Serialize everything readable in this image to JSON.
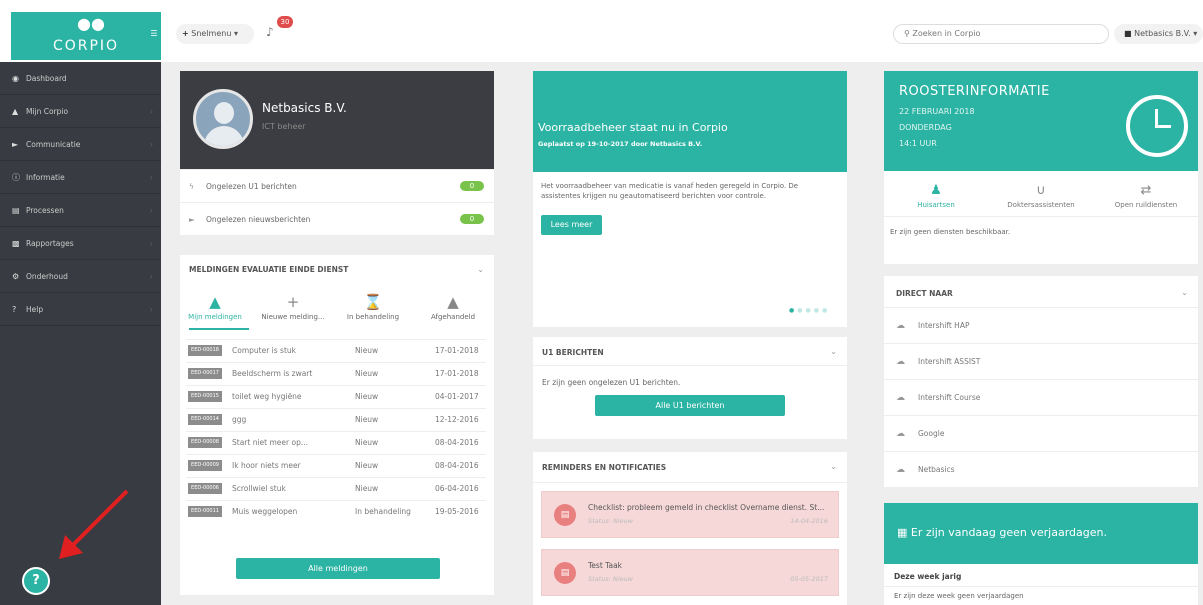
{
  "topbar": {
    "logo_text": "CORPIO",
    "menu_toggle_icon": "menu-icon",
    "quick_menu_label": "Snelmenu ▾",
    "notifications_count": "30",
    "search_placeholder": "Zoeken in Corpio",
    "user_label": "Netbasics B.V. ▾"
  },
  "sidebar": {
    "items": [
      {
        "label": "Dashboard",
        "icon": "dashboard-icon"
      },
      {
        "label": "Mijn Corpio",
        "icon": "user-icon"
      },
      {
        "label": "Communicatie",
        "icon": "megaphone-icon"
      },
      {
        "label": "Informatie",
        "icon": "info-icon"
      },
      {
        "label": "Processen",
        "icon": "list-icon"
      },
      {
        "label": "Rapportages",
        "icon": "bar-chart-icon"
      },
      {
        "label": "Onderhoud",
        "icon": "gear-icon"
      },
      {
        "label": "Help",
        "icon": "question-icon"
      }
    ],
    "help_button": "?"
  },
  "profile": {
    "name": "Netbasics B.V.",
    "role": "ICT beheer",
    "stats": [
      {
        "label": "Ongelezen U1 berichten",
        "count": "0"
      },
      {
        "label": "Ongelezen nieuwsberichten",
        "count": "0"
      }
    ]
  },
  "meldingen": {
    "title": "MELDINGEN EVALUATIE EINDE DIENST",
    "tabs": [
      "Mijn meldingen",
      "Nieuwe melding...",
      "In behandeling",
      "Afgehandeld"
    ],
    "rows": [
      {
        "code": "EED-00018",
        "title": "Computer is stuk",
        "status": "Nieuw",
        "date": "17-01-2018"
      },
      {
        "code": "EED-00017",
        "title": "Beeldscherm is zwart",
        "status": "Nieuw",
        "date": "17-01-2018"
      },
      {
        "code": "EED-00015",
        "title": "toilet weg hygiëne",
        "status": "Nieuw",
        "date": "04-01-2017"
      },
      {
        "code": "EED-00014",
        "title": "ggg",
        "status": "Nieuw",
        "date": "12-12-2016"
      },
      {
        "code": "EED-00008",
        "title": "Start niet meer op...",
        "status": "Nieuw",
        "date": "08-04-2016"
      },
      {
        "code": "EED-00009",
        "title": "Ik hoor niets meer",
        "status": "Nieuw",
        "date": "08-04-2016"
      },
      {
        "code": "EED-00006",
        "title": "Scrollwiel stuk",
        "status": "Nieuw",
        "date": "06-04-2016"
      },
      {
        "code": "EED-00011",
        "title": "Muis weggelopen",
        "status": "In behandeling",
        "date": "19-05-2016"
      }
    ],
    "button": "Alle meldingen"
  },
  "news": {
    "title": "Voorraadbeheer staat nu in Corpio",
    "subtitle": "Geplaatst op 19-10-2017 door Netbasics B.V.",
    "body": "Het voorraadbeheer van medicatie is vanaf heden geregeld in Corpio. De assistentes krijgen nu geautomatiseerd berichten voor controle.",
    "button": "Lees meer"
  },
  "u1": {
    "title": "U1 BERICHTEN",
    "text": "Er zijn geen ongelezen U1 berichten.",
    "button": "Alle U1 berichten"
  },
  "reminders": {
    "title": "REMINDERS EN NOTIFICATIES",
    "items": [
      {
        "title": "Checklist: probleem gemeld in checklist Overname dienst. St...",
        "status": "Status: Nieuw",
        "date": "14-04-2016"
      },
      {
        "title": "Test Taak",
        "status": "Status: Nieuw",
        "date": "05-05-2017"
      }
    ]
  },
  "rooster": {
    "title": "ROOSTERINFORMATIE",
    "date": "22 FEBRUARI 2018",
    "day": "DONDERDAG",
    "time": "14:1 UUR",
    "tabs": [
      "Huisartsen",
      "Doktersassistenten",
      "Open ruildiensten"
    ],
    "empty_text": "Er zijn geen diensten beschikbaar."
  },
  "direct": {
    "title": "DIRECT NAAR",
    "links": [
      "Intershift HAP",
      "Intershift ASSIST",
      "Intershift Course",
      "Google",
      "Netbasics"
    ]
  },
  "birthdays": {
    "banner": "Er zijn vandaag geen verjaardagen.",
    "week_title": "Deze week jarig",
    "week_text": "Er zijn deze week geen verjaardagen"
  },
  "colors": {
    "accent": "#2bb3a3",
    "sidebar": "#383b41",
    "badge": "#e04b4b",
    "pill": "#79c34b"
  }
}
